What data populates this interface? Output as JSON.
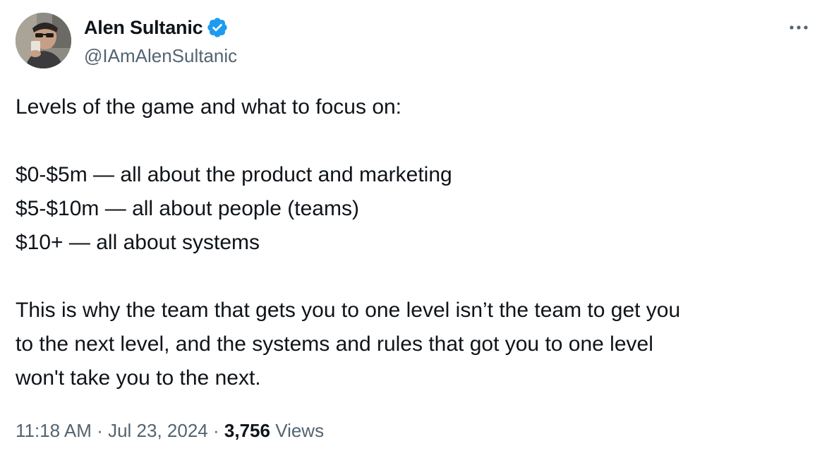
{
  "author": {
    "display_name": "Alen Sultanic",
    "handle": "@IAmAlenSultanic",
    "verified": true,
    "verified_color": "#1d9bf0"
  },
  "menu": {
    "icon": "more-horizontal-icon"
  },
  "tweet": {
    "intro": "Levels of the game and what to focus on:",
    "levels": [
      "$0-$5m — all about the product and marketing",
      "$5-$10m — all about people (teams)",
      "$10+ — all about systems"
    ],
    "closing_lines": [
      "This is why the team that gets you to one level isn’t the team to get you",
      "to the next level, and the systems and rules that got you to one level",
      "won't take you to the next."
    ]
  },
  "meta": {
    "time": "11:18 AM",
    "separator": "·",
    "date": "Jul 23, 2024",
    "views_count": "3,756",
    "views_label": "Views"
  }
}
